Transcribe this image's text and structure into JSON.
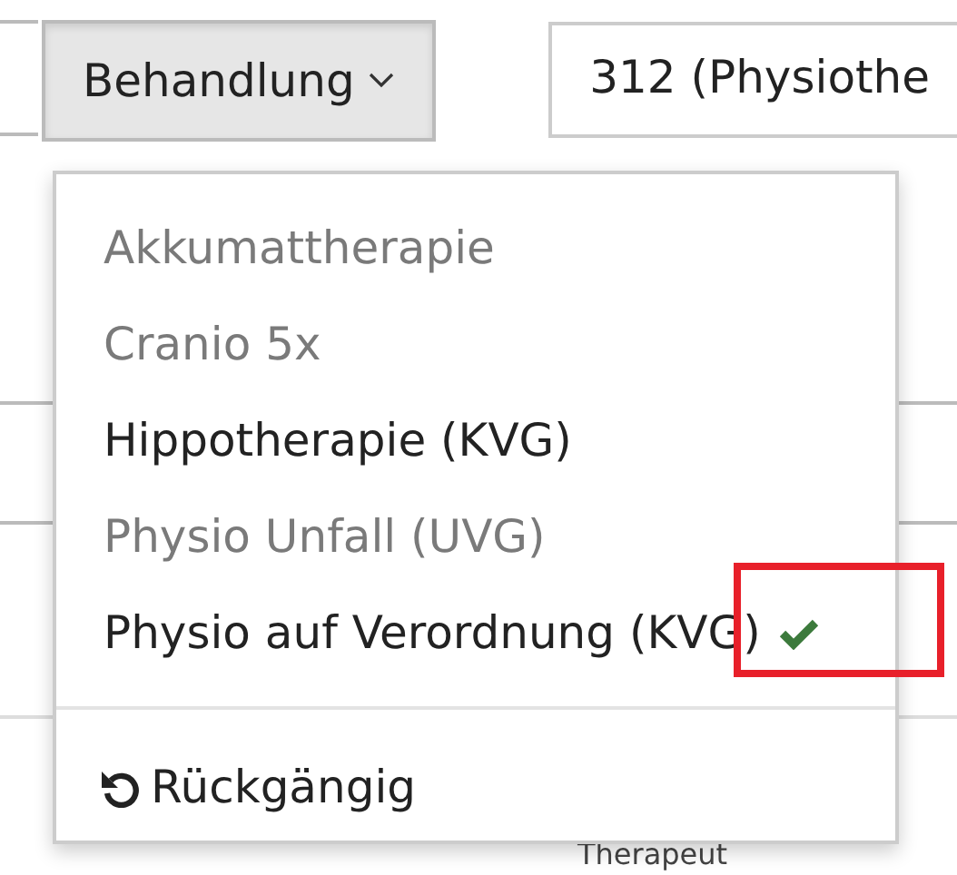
{
  "toolbar": {
    "filter_button": {
      "label": "Behandlung",
      "expanded": true
    },
    "selection_field": {
      "value": "312 (Physiothe"
    }
  },
  "background": {
    "column_label": "Therapeut"
  },
  "menu": {
    "items": [
      {
        "label": "Akkumattherapie",
        "disabled": true,
        "selected": false
      },
      {
        "label": "Cranio 5x",
        "disabled": true,
        "selected": false
      },
      {
        "label": "Hippotherapie (KVG)",
        "disabled": false,
        "selected": false
      },
      {
        "label": "Physio Unfall (UVG)",
        "disabled": true,
        "selected": false
      },
      {
        "label": "Physio auf Verordnung (KVG)",
        "disabled": false,
        "selected": true
      }
    ],
    "undo": {
      "label": "Rückgängig"
    }
  },
  "annotation": {
    "highlight": true
  }
}
